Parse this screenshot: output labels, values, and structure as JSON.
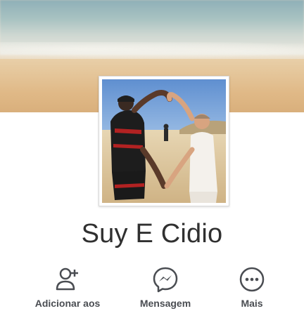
{
  "profile": {
    "name": "Suy E Cidio"
  },
  "actions": [
    {
      "label": "Adicionar aos",
      "icon": "add-friend-icon"
    },
    {
      "label": "Mensagem",
      "icon": "messenger-icon"
    },
    {
      "label": "Mais",
      "icon": "more-icon"
    }
  ],
  "colors": {
    "icon": "#4a4d52",
    "text": "#303030"
  }
}
